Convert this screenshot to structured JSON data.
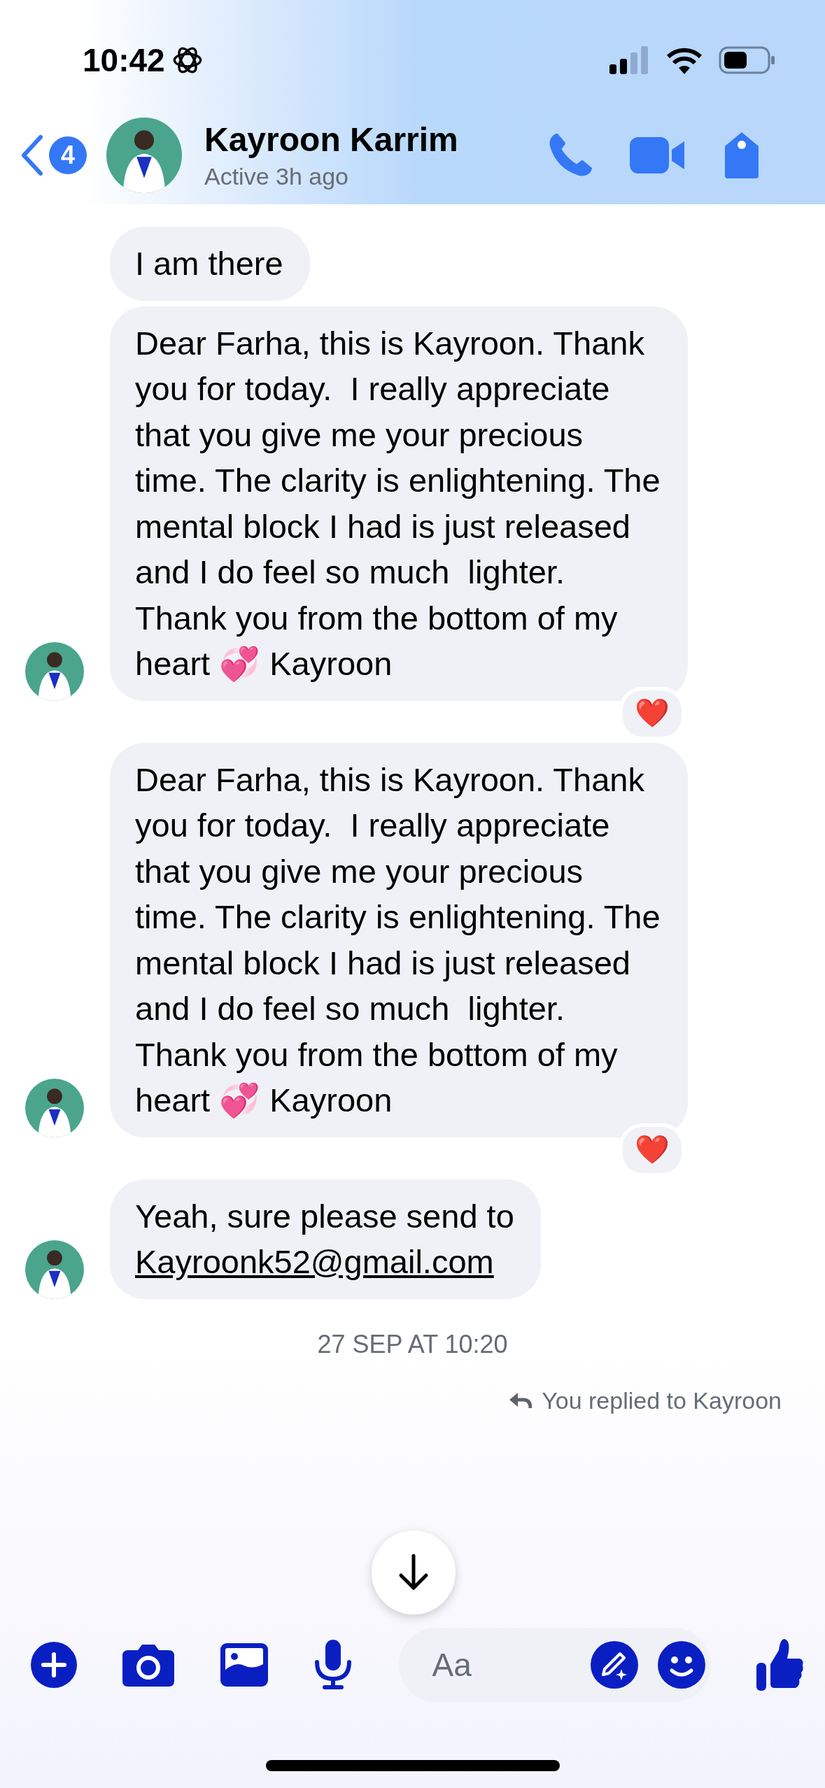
{
  "status_bar": {
    "time": "10:42"
  },
  "header": {
    "back_badge": "4",
    "name": "Kayroon Karrim",
    "status": "Active 3h ago"
  },
  "messages": [
    {
      "text": "I am there",
      "avatar": false
    },
    {
      "text": "Dear Farha, this is Kayroon. Thank you for today.  I really appreciate that you give me your precious time. The clarity is enlightening. The mental block I had is just released and I do feel so much  lighter. Thank you from the bottom of my heart 💞 Kayroon",
      "avatar": true,
      "reaction": "❤️"
    },
    {
      "text": "Dear Farha, this is Kayroon. Thank you for today.  I really appreciate that you give me your precious time. The clarity is enlightening. The mental block I had is just released and I do feel so much  lighter. Thank you from the bottom of my heart 💞 Kayroon",
      "avatar": true,
      "reaction": "❤️"
    },
    {
      "text": "Yeah, sure please send to",
      "link": "Kayroonk52@gmail.com",
      "avatar": true
    }
  ],
  "timestamp": "27 SEP AT 10:20",
  "reply_note": "You replied to Kayroon",
  "composer": {
    "placeholder": "Aa"
  }
}
